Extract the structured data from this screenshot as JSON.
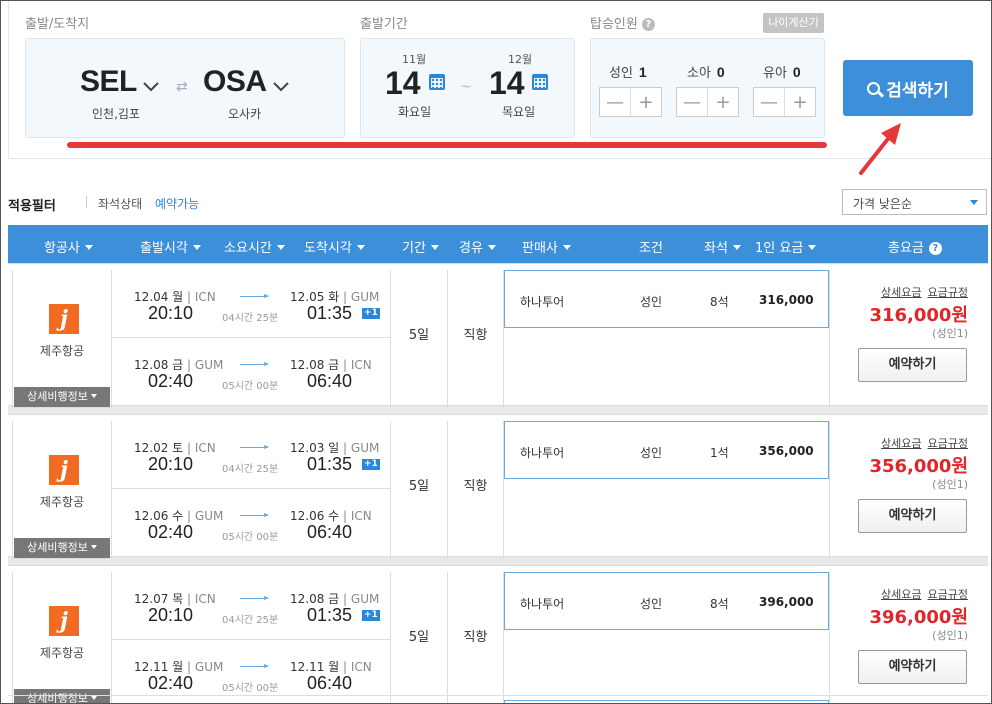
{
  "search": {
    "route_label": "출발/도착지",
    "period_label": "출발기간",
    "pax_label": "탑승인원",
    "calc_button": "나이계산기",
    "origin": {
      "code": "SEL",
      "name": "인천,김포"
    },
    "destination": {
      "code": "OSA",
      "name": "오사카"
    },
    "swap_glyph": "⇄",
    "depart": {
      "month": "11월",
      "day": "14",
      "weekday": "화요일"
    },
    "return": {
      "month": "12월",
      "day": "14",
      "weekday": "목요일"
    },
    "tilde": "~",
    "pax": [
      {
        "label": "성인",
        "count": "1"
      },
      {
        "label": "소아",
        "count": "0"
      },
      {
        "label": "유아",
        "count": "0"
      }
    ],
    "search_button": "검색하기"
  },
  "filter": {
    "title": "적용필터",
    "key": "좌석상태",
    "value": "예약가능",
    "sort": "가격 낮은순"
  },
  "columns": [
    "항공사",
    "출발시각",
    "소요시간",
    "도착시각",
    "기간",
    "경유",
    "판매사",
    "조건",
    "좌석",
    "1인 요금",
    "총요금"
  ],
  "results": [
    {
      "airline": "제주항공",
      "logo": "j",
      "detail": "상세비행정보",
      "out": {
        "date1": "12.04 월",
        "ap1": "ICN",
        "time1": "20:10",
        "dur": "04시간 25분",
        "date2": "12.05 화",
        "ap2": "GUM",
        "time2": "01:35",
        "plus": "+1"
      },
      "ret": {
        "date1": "12.08 금",
        "ap1": "GUM",
        "time1": "02:40",
        "dur": "05시간 00분",
        "date2": "12.08 금",
        "ap2": "ICN",
        "time2": "06:40"
      },
      "period": "5일",
      "route": "직항",
      "seller": "하나투어",
      "cond": "성인",
      "seats": "8석",
      "fare": "316,000",
      "link1": "상세요금",
      "link2": "요금규정",
      "total": "316,000원",
      "per": "(성인1)",
      "book": "예약하기"
    },
    {
      "airline": "제주항공",
      "logo": "j",
      "detail": "상세비행정보",
      "out": {
        "date1": "12.02 토",
        "ap1": "ICN",
        "time1": "20:10",
        "dur": "04시간 25분",
        "date2": "12.03 일",
        "ap2": "GUM",
        "time2": "01:35",
        "plus": "+1"
      },
      "ret": {
        "date1": "12.06 수",
        "ap1": "GUM",
        "time1": "02:40",
        "dur": "05시간 00분",
        "date2": "12.06 수",
        "ap2": "ICN",
        "time2": "06:40"
      },
      "period": "5일",
      "route": "직항",
      "seller": "하나투어",
      "cond": "성인",
      "seats": "1석",
      "fare": "356,000",
      "link1": "상세요금",
      "link2": "요금규정",
      "total": "356,000원",
      "per": "(성인1)",
      "book": "예약하기"
    },
    {
      "airline": "제주항공",
      "logo": "j",
      "detail": "상세비행정보",
      "out": {
        "date1": "12.07 목",
        "ap1": "ICN",
        "time1": "20:10",
        "dur": "04시간 25분",
        "date2": "12.08 금",
        "ap2": "GUM",
        "time2": "01:35",
        "plus": "+1"
      },
      "ret": {
        "date1": "12.11 월",
        "ap1": "GUM",
        "time1": "02:40",
        "dur": "05시간 00분",
        "date2": "12.11 월",
        "ap2": "ICN",
        "time2": "06:40"
      },
      "period": "5일",
      "route": "직항",
      "seller": "하나투어",
      "cond": "성인",
      "seats": "8석",
      "fare": "396,000",
      "link1": "상세요금",
      "link2": "요금규정",
      "total": "396,000원",
      "per": "(성인1)",
      "book": "예약하기"
    }
  ],
  "colors": {
    "accent": "#3d8fd9",
    "price": "#e0262a",
    "annotation": "#e5383b",
    "airline_logo": "#f26b22"
  }
}
